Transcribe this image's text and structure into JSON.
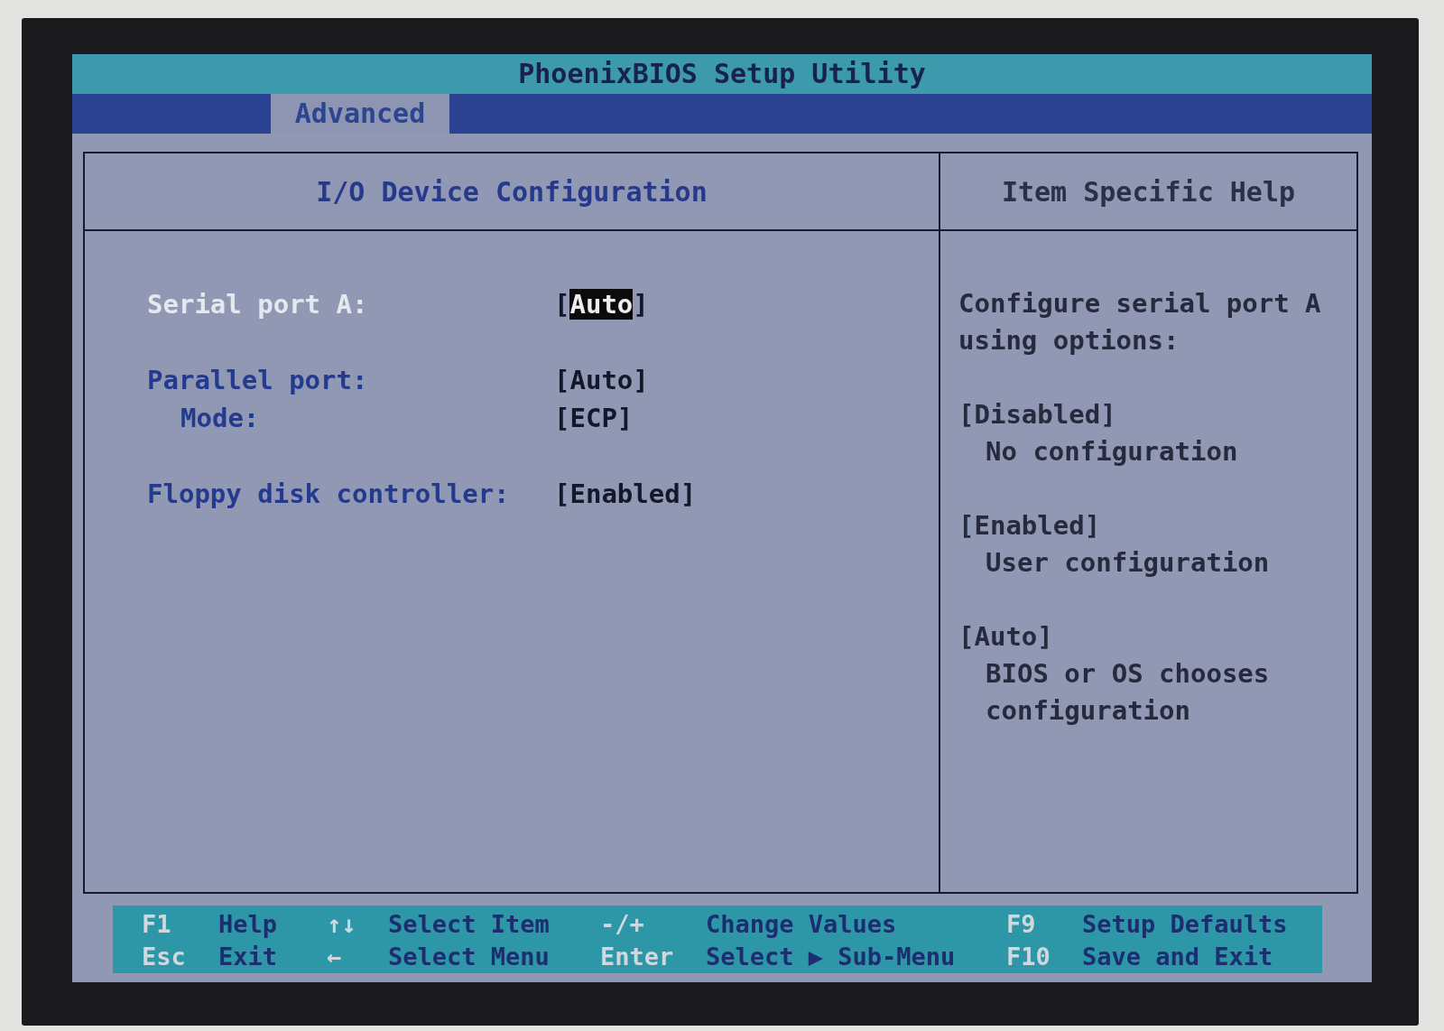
{
  "title": "PhoenixBIOS Setup Utility",
  "menu": {
    "tabs": [
      {
        "label": "Advanced",
        "selected": true
      }
    ]
  },
  "panel": {
    "heading": "I/O Device Configuration",
    "items": [
      {
        "label": "Serial port A:",
        "value": "[Auto]",
        "selected": true
      },
      {
        "label": "Parallel port:",
        "value": "[Auto]",
        "selected": false,
        "children": [
          {
            "label": "Mode:",
            "value": "[ECP]",
            "selected": false
          }
        ]
      },
      {
        "label": "Floppy disk controller:",
        "value": "[Enabled]",
        "selected": false
      }
    ]
  },
  "help": {
    "heading": "Item Specific Help",
    "intro": "Configure serial port A using options:",
    "options": [
      {
        "name": "[Disabled]",
        "description": "No configuration"
      },
      {
        "name": "[Enabled]",
        "description": "User configuration"
      },
      {
        "name": "[Auto]",
        "description": "BIOS or OS chooses configuration"
      }
    ]
  },
  "key_legend": [
    {
      "key": "F1",
      "action": "Help"
    },
    {
      "key": "↑↓",
      "action": "Select Item"
    },
    {
      "key": "-/+",
      "action": "Change Values"
    },
    {
      "key": "F9",
      "action": "Setup Defaults"
    },
    {
      "key": "Esc",
      "action": "Exit"
    },
    {
      "key": "←",
      "action": "Select Menu"
    },
    {
      "key": "Enter",
      "action": "Select ▶ Sub-Menu"
    },
    {
      "key": "F10",
      "action": "Save and Exit"
    }
  ]
}
